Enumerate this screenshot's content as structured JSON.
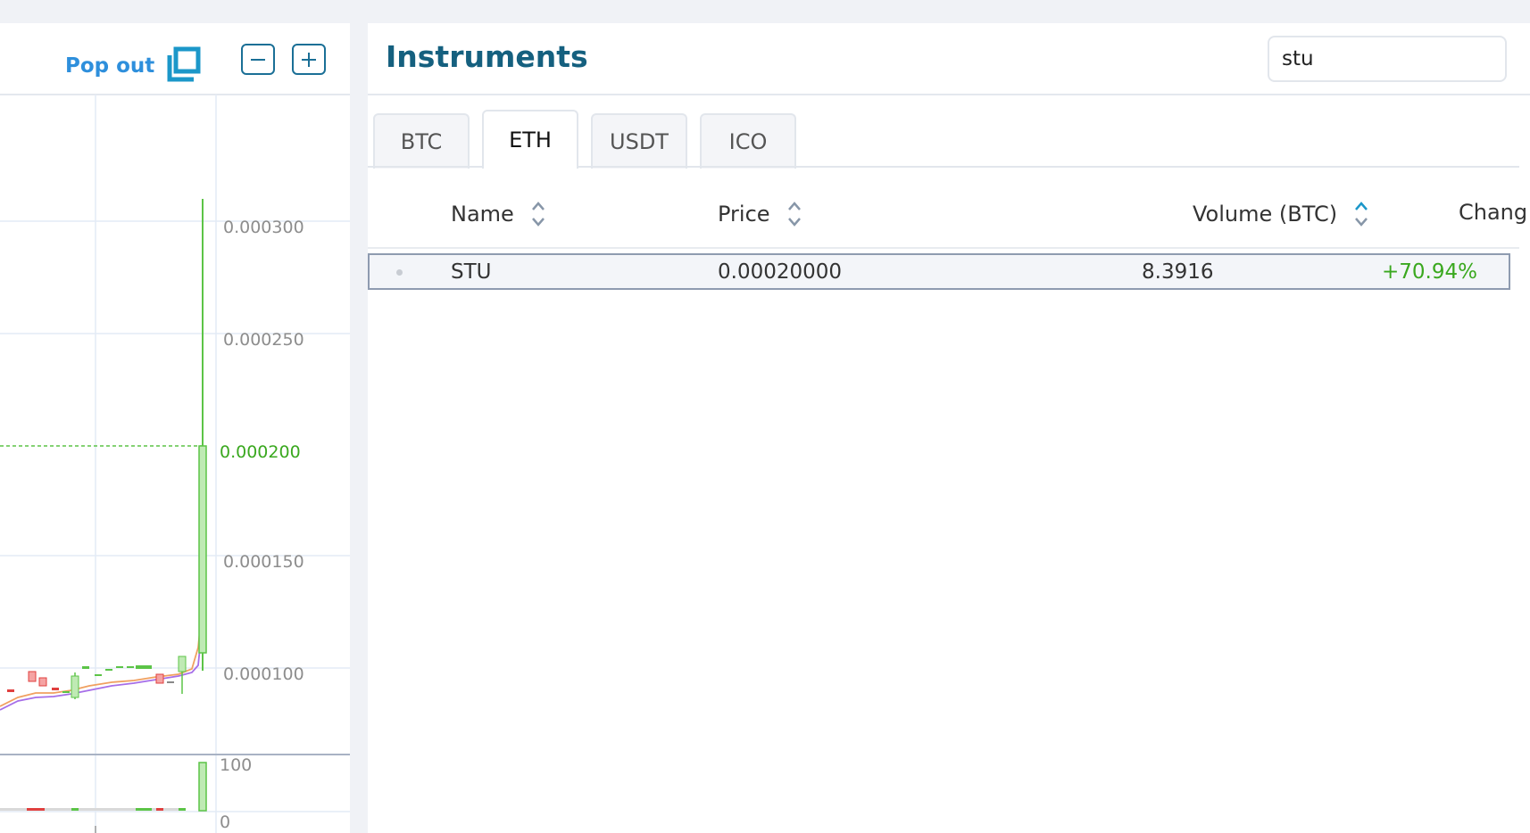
{
  "colors": {
    "accent": "#15607f",
    "link": "#2e8fdc",
    "up": "#3aa81f",
    "down": "#e0403f"
  },
  "chart_panel": {
    "pop_out_label": "Pop out",
    "icons": [
      "popout-icon",
      "zoom-out-icon",
      "zoom-in-icon"
    ]
  },
  "chart_data": {
    "type": "candlestick",
    "price_ticks": [
      "0.000300",
      "0.000250",
      "0.000200",
      "0.000150",
      "0.000100"
    ],
    "current_price_label": "0.000200",
    "volume_ticks": [
      "100",
      "0"
    ],
    "ylim": [
      8e-05,
      0.00033
    ],
    "current_price": 0.0002
  },
  "instruments": {
    "title": "Instruments",
    "search_value": "stu",
    "tabs": [
      {
        "label": "BTC",
        "active": false
      },
      {
        "label": "ETH",
        "active": true
      },
      {
        "label": "USDT",
        "active": false
      },
      {
        "label": "ICO",
        "active": false
      }
    ],
    "columns": [
      "Name",
      "Price",
      "Volume (BTC)",
      "Chang"
    ],
    "rows": [
      {
        "name": "STU",
        "price": "0.00020000",
        "volume": "8.3916",
        "change": "+70.94%"
      }
    ]
  }
}
